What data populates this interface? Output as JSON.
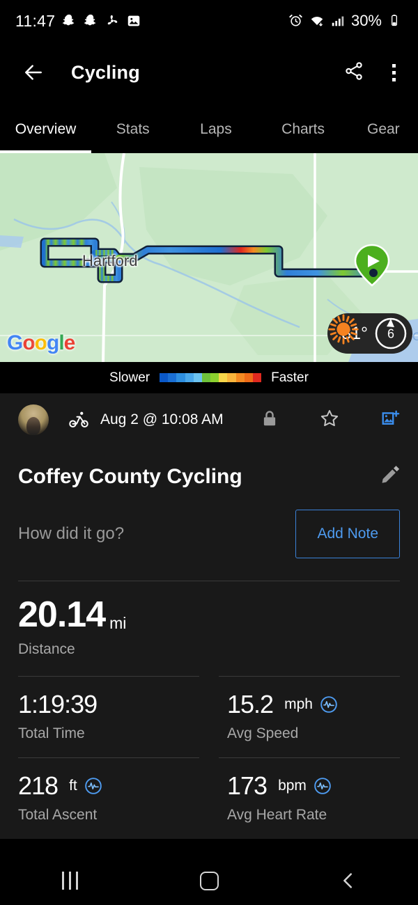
{
  "status_bar": {
    "time": "11:47",
    "battery": "30%",
    "icons": [
      "snapchat-icon",
      "snapchat-icon",
      "pinwheel-icon",
      "photos-icon"
    ],
    "right_icons": [
      "alarm-icon",
      "wifi-icon",
      "cellular-signal-icon",
      "battery-icon"
    ]
  },
  "app_bar": {
    "title": "Cycling",
    "back_icon": "back-arrow-icon",
    "share_icon": "share-icon",
    "menu_icon": "overflow-menu-icon"
  },
  "tabs": {
    "active_index": 0,
    "items": [
      {
        "label": "Overview"
      },
      {
        "label": "Stats"
      },
      {
        "label": "Laps"
      },
      {
        "label": "Charts"
      },
      {
        "label": "Gear"
      }
    ]
  },
  "map": {
    "city_label": "Hartford",
    "attribution": "Google",
    "attribution_letters": [
      "G",
      "o",
      "o",
      "g",
      "l",
      "e"
    ],
    "edge_text": "Ot",
    "start_marker": "start-pin-play-icon",
    "weather": {
      "temperature": "81°",
      "condition_icon": "sun-icon",
      "wind_value": "6"
    },
    "route_color_note": "speed-gradient-track"
  },
  "legend": {
    "slower_label": "Slower",
    "faster_label": "Faster",
    "colors": [
      "#0a58c8",
      "#1a6fd4",
      "#2e8fe0",
      "#4aa8ea",
      "#6cc3f0",
      "#6fc23a",
      "#8cd12f",
      "#f7d74a",
      "#f9b53c",
      "#f48a22",
      "#ef6b18",
      "#e0291f"
    ]
  },
  "activity_meta": {
    "avatar": "user-avatar",
    "sport_icon": "cycling-icon",
    "date": "Aug 2 @ 10:08 AM",
    "privacy_icon": "lock-icon",
    "favorite_icon": "star-icon",
    "add_photo_icon": "add-photo-icon"
  },
  "activity": {
    "title": "Coffey County Cycling",
    "edit_icon": "pencil-icon",
    "note_placeholder": "How did it go?",
    "add_note_label": "Add Note"
  },
  "stats": {
    "primary": {
      "value": "20.14",
      "unit": "mi",
      "label": "Distance"
    },
    "grid": [
      {
        "value": "1:19:39",
        "unit": "",
        "label": "Total Time",
        "has_chart_icon": false
      },
      {
        "value": "15.2",
        "unit": "mph",
        "label": "Avg Speed",
        "has_chart_icon": true
      },
      {
        "value": "218",
        "unit": "ft",
        "label": "Total Ascent",
        "has_chart_icon": true
      },
      {
        "value": "173",
        "unit": "bpm",
        "label": "Avg Heart Rate",
        "has_chart_icon": true
      }
    ],
    "chart_icon_name": "chart-waveform-icon",
    "accent_color": "#4e9bf0"
  },
  "nav_bar": {
    "recents_icon": "recents-icon",
    "home_icon": "home-icon",
    "back_icon": "nav-back-icon"
  }
}
